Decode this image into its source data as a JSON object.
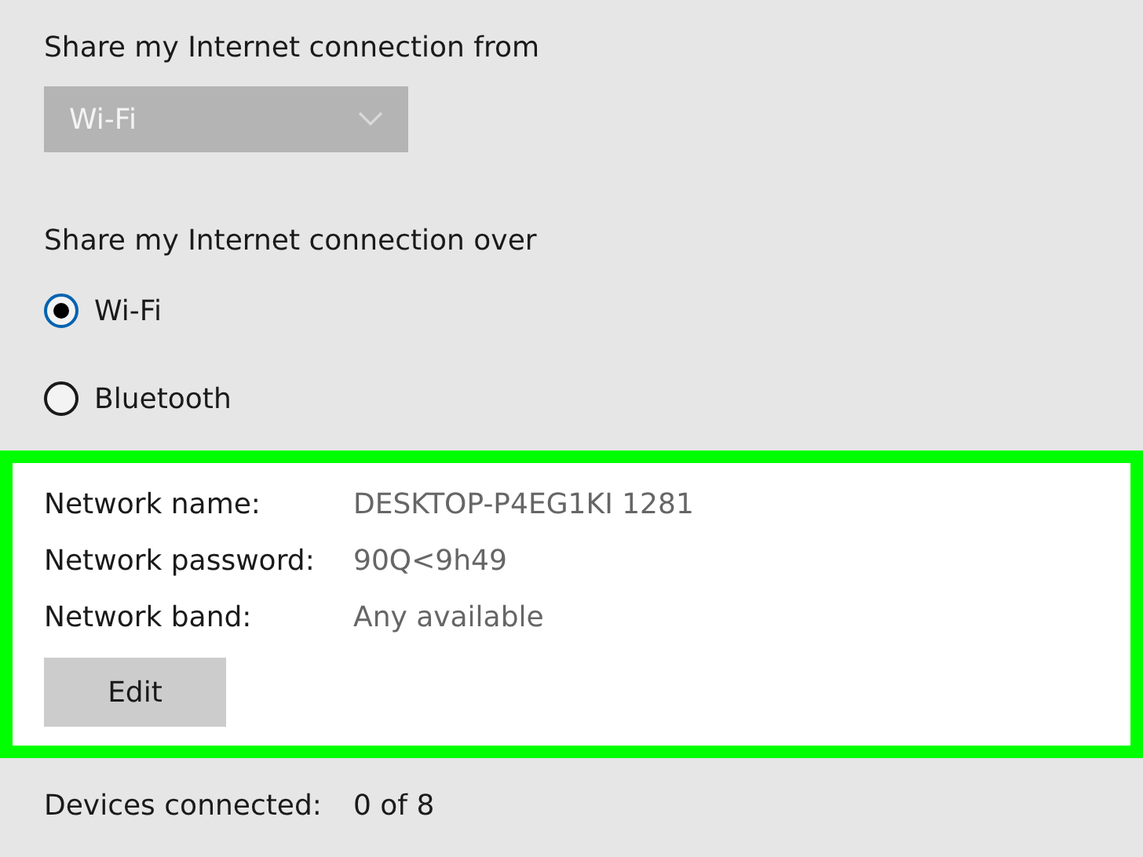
{
  "share_from": {
    "label": "Share my Internet connection from",
    "dropdown": {
      "value": "Wi-Fi",
      "disabled": true
    }
  },
  "share_over": {
    "label": "Share my Internet connection over",
    "options": [
      {
        "label": "Wi-Fi",
        "selected": true
      },
      {
        "label": "Bluetooth",
        "selected": false
      }
    ]
  },
  "network_info": {
    "highlighted": true,
    "rows": [
      {
        "label": "Network name:",
        "value": "DESKTOP-P4EG1KI 1281"
      },
      {
        "label": "Network password:",
        "value": "90Q<9h49"
      },
      {
        "label": "Network band:",
        "value": "Any available"
      }
    ],
    "edit_button": "Edit"
  },
  "devices": {
    "label": "Devices connected:",
    "value": "0 of 8"
  }
}
